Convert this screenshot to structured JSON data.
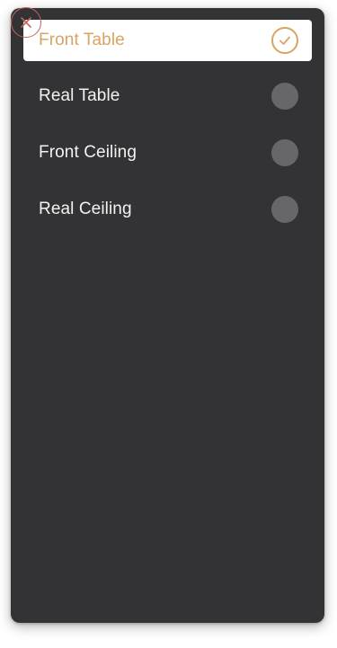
{
  "options": [
    {
      "label": "Front Table",
      "selected": true
    },
    {
      "label": "Real Table",
      "selected": false
    },
    {
      "label": "Front Ceiling",
      "selected": false
    },
    {
      "label": "Real Ceiling",
      "selected": false
    }
  ],
  "colors": {
    "panel_bg": "#333335",
    "accent": "#d9a363",
    "unselected_indicator": "#67676b",
    "close_ring": "#c7625a"
  },
  "icons": {
    "close": "close-icon",
    "check": "checkmark-circle-icon"
  }
}
